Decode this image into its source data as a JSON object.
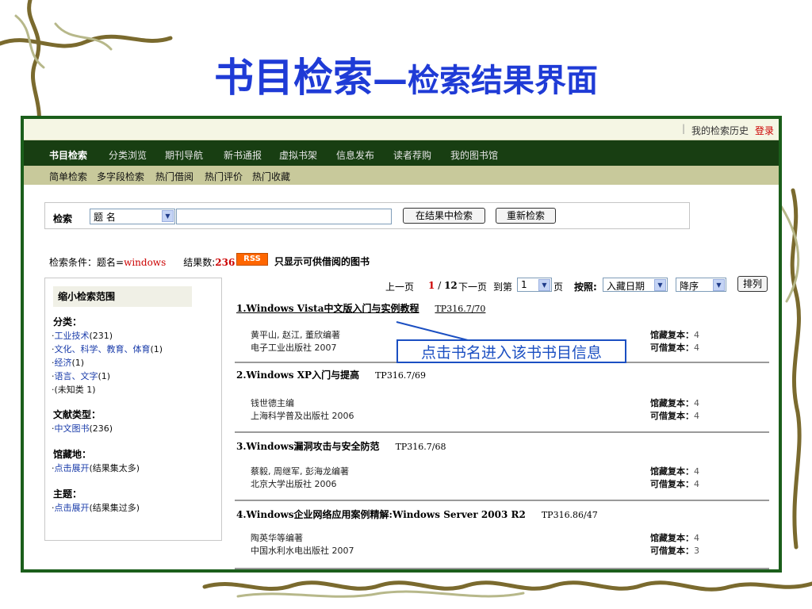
{
  "slide": {
    "title_main": "书目检索",
    "title_dash": "—",
    "title_sub": "检索结果界面"
  },
  "topbar": {
    "separator": "|",
    "history": "我的检索历史",
    "login": "登录"
  },
  "nav": {
    "items": [
      "书目检索",
      "分类浏览",
      "期刊导航",
      "新书通报",
      "虚拟书架",
      "信息发布",
      "读者荐购",
      "我的图书馆"
    ]
  },
  "subnav": {
    "items": [
      "简单检索",
      "多字段检索",
      "热门借阅",
      "热门评价",
      "热门收藏"
    ]
  },
  "search": {
    "label": "检索",
    "field_select": "题 名",
    "query": "",
    "btn_in_results": "在结果中检索",
    "btn_reset": "重新检索"
  },
  "condition": {
    "prefix": "检索条件：题名=",
    "keyword": "windows",
    "count_label": "结果数:",
    "count": "236",
    "rss": "RSS",
    "only_available": "只显示可供借阅的图书"
  },
  "sidebar": {
    "title": "缩小检索范围",
    "sections": [
      {
        "heading": "分类：",
        "items": [
          {
            "text": "工业技术",
            "count": "(231)"
          },
          {
            "text": "文化、科学、教育、体育",
            "count": "(1)"
          },
          {
            "text": "经济",
            "count": "(1)"
          },
          {
            "text": "语言、文字",
            "count": "(1)"
          },
          {
            "text": "(未知类",
            "count": " 1)"
          }
        ]
      },
      {
        "heading": "文献类型：",
        "items": [
          {
            "text": "中文图书",
            "count": "(236)"
          }
        ]
      },
      {
        "heading": "馆藏地：",
        "items": [
          {
            "text": "点击展开",
            "count": "(结果集太多)"
          }
        ]
      },
      {
        "heading": "主题：",
        "items": [
          {
            "text": "点击展开",
            "count": "(结果集过多)"
          }
        ]
      }
    ]
  },
  "pager": {
    "prev": "上一页",
    "current": "1",
    "sep": "/",
    "total": "12",
    "next": "下一页",
    "goto": "到第",
    "page_value": "1",
    "page_unit": "页",
    "sort_label": "按照:",
    "sort_field": "入藏日期",
    "order": "降序",
    "sort_button": "排列"
  },
  "results": [
    {
      "title": "1.Windows Vista中文版入门与实例教程",
      "code": "TP316.7/70",
      "author": "黄平山, 赵江, 董欣编著",
      "publisher": "电子工业出版社 2007",
      "copies_label": "馆藏复本：",
      "copies": "4",
      "avail_label": "可借复本：",
      "avail": "4"
    },
    {
      "title": "2.Windows XP入门与提高",
      "code": "TP316.7/69",
      "author": "钱世德主编",
      "publisher": "上海科学普及出版社 2006",
      "copies_label": "馆藏复本：",
      "copies": "4",
      "avail_label": "可借复本：",
      "avail": "4"
    },
    {
      "title": "3.Windows漏洞攻击与安全防范",
      "code": "TP316.7/68",
      "author": "蔡毅, 周继军, 彭海龙编著",
      "publisher": "北京大学出版社 2006",
      "copies_label": "馆藏复本：",
      "copies": "4",
      "avail_label": "可借复本：",
      "avail": "4"
    },
    {
      "title": "4.Windows企业网络应用案例精解:Windows Server 2003 R2",
      "code": "TP316.86/47",
      "author": "陶英华等编著",
      "publisher": "中国水利水电出版社 2007",
      "copies_label": "馆藏复本：",
      "copies": "4",
      "avail_label": "可借复本：",
      "avail": "3"
    }
  ],
  "callout": "点击书名进入该书书目信息",
  "colors": {
    "title_blue": "#1f3bd6",
    "nav_green": "#183e12",
    "subnav_khaki": "#c8c99b",
    "frame_green": "#1b5e1b",
    "rss_orange": "#ff6600",
    "count_red": "#cc0000"
  }
}
